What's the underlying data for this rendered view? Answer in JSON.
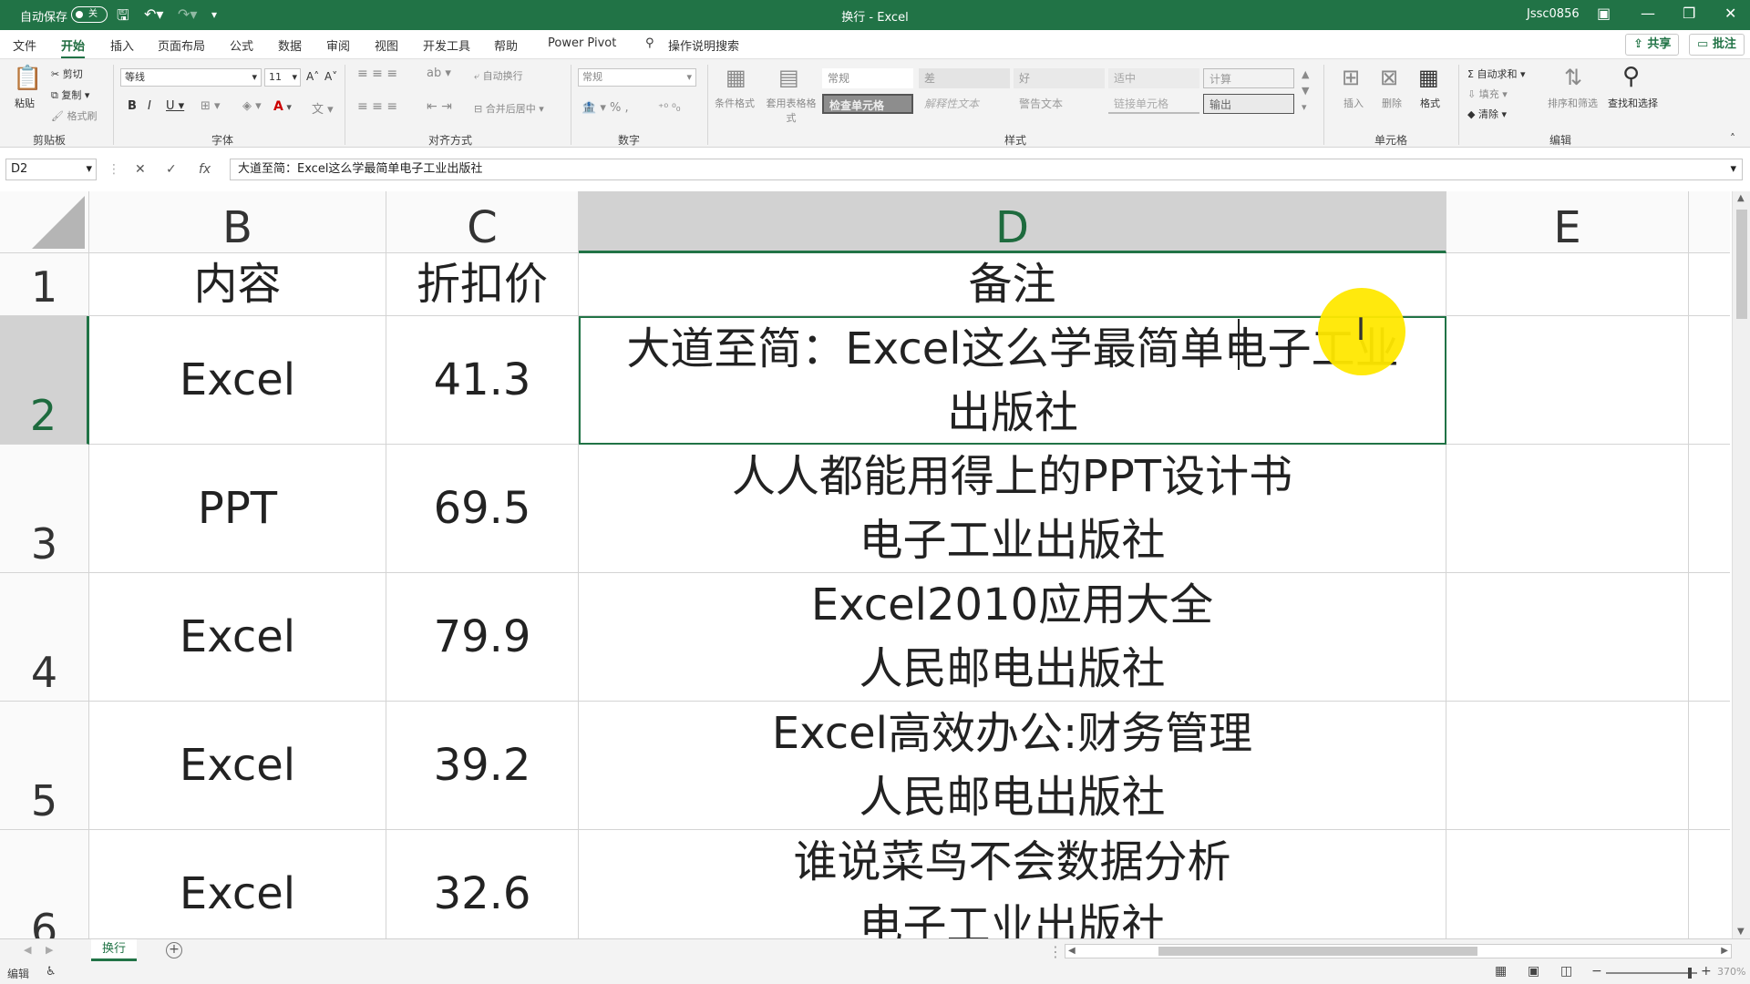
{
  "titlebar": {
    "autosave_label": "自动保存",
    "autosave_state": "关",
    "title": "换行 - Excel",
    "user": "Jssc0856"
  },
  "menu": {
    "tabs": [
      "文件",
      "开始",
      "插入",
      "页面布局",
      "公式",
      "数据",
      "审阅",
      "视图",
      "开发工具",
      "帮助",
      "Power Pivot"
    ],
    "active_tab": "开始",
    "search": "操作说明搜索",
    "share": "共享",
    "comment": "批注"
  },
  "ribbon": {
    "clipboard": {
      "paste": "粘贴",
      "cut": "剪切",
      "copy": "复制",
      "painter": "格式刷",
      "group": "剪贴板"
    },
    "font": {
      "name": "等线",
      "size": "11",
      "group": "字体"
    },
    "alignment": {
      "wrap": "自动换行",
      "merge": "合并后居中",
      "group": "对齐方式"
    },
    "number": {
      "format": "常规",
      "group": "数字"
    },
    "styles": {
      "conditional": "条件格式",
      "table": "套用表格格式",
      "cells": [
        "常规",
        "差",
        "好",
        "适中",
        "计算",
        "检查单元格",
        "解释性文本",
        "警告文本",
        "链接单元格",
        "输出"
      ],
      "group": "样式"
    },
    "cells": {
      "insert": "插入",
      "delete": "删除",
      "format": "格式",
      "group": "单元格"
    },
    "editing": {
      "autosum": "自动求和",
      "fill": "填充",
      "clear": "清除",
      "sort": "排序和筛选",
      "find": "查找和选择",
      "group": "编辑"
    }
  },
  "formula_bar": {
    "name_box": "D2",
    "formula": "大道至简：Excel这么学最简单电子工业出版社"
  },
  "sheet": {
    "columns": [
      "B",
      "C",
      "D",
      "E"
    ],
    "rows": [
      {
        "num": "1",
        "b": "内容",
        "c": "折扣价",
        "d1": "备注",
        "d2": ""
      },
      {
        "num": "2",
        "b": "Excel",
        "c": "41.3",
        "d1": "大道至简：Excel这么学最简单电子工业",
        "d2": "出版社"
      },
      {
        "num": "3",
        "b": "PPT",
        "c": "69.5",
        "d1": "人人都能用得上的PPT设计书",
        "d2": "电子工业出版社"
      },
      {
        "num": "4",
        "b": "Excel",
        "c": "79.9",
        "d1": "Excel2010应用大全",
        "d2": "人民邮电出版社"
      },
      {
        "num": "5",
        "b": "Excel",
        "c": "39.2",
        "d1": "Excel高效办公:财务管理",
        "d2": "人民邮电出版社"
      },
      {
        "num": "6",
        "b": "Excel",
        "c": "32.6",
        "d1": "谁说菜鸟不会数据分析",
        "d2": "电子工业出版社"
      }
    ]
  },
  "sheet_tab": "换行",
  "status": {
    "mode": "编辑",
    "zoom": "370%"
  },
  "colors": {
    "accent": "#217346",
    "highlight": "#ffe800"
  }
}
